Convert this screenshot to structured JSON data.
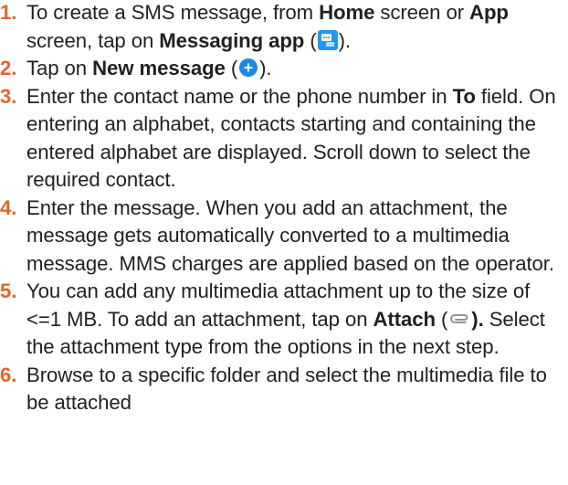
{
  "steps": [
    {
      "num": "1.",
      "text_a": "To create a SMS message, from ",
      "bold_a": "Home",
      "text_b": " screen or ",
      "bold_b": "App",
      "text_c": " screen, tap on ",
      "bold_c": "Messaging app",
      "text_d": " (",
      "icon": "messaging-app-icon",
      "text_e": ")."
    },
    {
      "num": "2.",
      "text_a": "Tap on ",
      "bold_a": "New message",
      "text_b": " (",
      "icon": "new-message-plus-icon",
      "text_c": ")."
    },
    {
      "num": "3.",
      "text_a": "Enter the contact name or the phone number in ",
      "bold_a": "To",
      "text_b": " field. On entering an alphabet, contacts starting and containing the entered alphabet are displayed. Scroll down to select the required contact."
    },
    {
      "num": "4.",
      "text_a": "Enter the message. When you add an attachment, the message gets automatically converted to a multimedia message. MMS charges are applied based on the operator."
    },
    {
      "num": "5.",
      "text_a": "You can add any multimedia attachment up to the size of <=1 MB. To add an attachment, tap on ",
      "bold_a": "Attach",
      "text_b": " (",
      "icon": "attach-paperclip-icon",
      "bold_b": ").",
      "text_c": " Select the attachment type from the options in the next step."
    },
    {
      "num": "6.",
      "text_a": "Browse to a specific folder and select the multimedia file to be attached"
    }
  ],
  "colors": {
    "step_number": "#e0662b",
    "body_text": "#231f20",
    "messaging_icon_bg": "#2196f3",
    "new_message_icon_bg": "#1e88e5",
    "attach_icon_stroke": "#888888"
  }
}
